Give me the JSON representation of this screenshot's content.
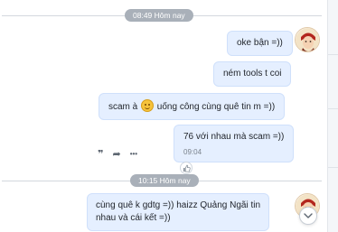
{
  "separators": [
    {
      "time": "08:49",
      "label": "Hôm nay"
    },
    {
      "time": "10:15",
      "label": "Hôm nay"
    }
  ],
  "messages": [
    {
      "text": "oke bận =))"
    },
    {
      "text": "ném tools t coi"
    },
    {
      "text_before": "scam à",
      "emoji": "smile-emoji",
      "text_after": "uống công cùng quê tin m =))"
    },
    {
      "text": "76 với nhau mà scam =))",
      "time": "09:04"
    }
  ],
  "incoming": {
    "line1": "cùng quê k gdtg =)) haizz Quảng Ngãi tin",
    "line2": "nhau và cái kết =))"
  },
  "actions": {
    "quote_icon": "quote-icon",
    "forward_icon": "forward-icon",
    "more_icon": "more-icon",
    "quote_glyph": "❞",
    "forward_glyph": "➦",
    "more_glyph": "•••"
  },
  "icons": {
    "like": "thumbs-up-icon",
    "scroll_down": "chevron-down-icon"
  },
  "colors": {
    "bubble_bg": "#e5efff",
    "bubble_border": "#cfe0fb",
    "pill_bg": "#a9b0b9"
  }
}
